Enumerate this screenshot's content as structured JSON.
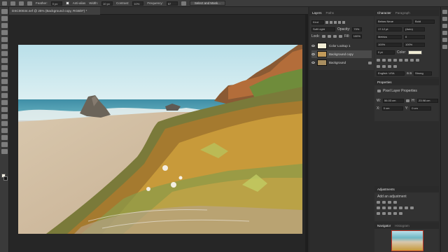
{
  "options_bar": {
    "feather_label": "Feather:",
    "feather_value": "0 px",
    "antialias_label": "Anti-alias",
    "width_label": "Width:",
    "width_value": "10 px",
    "contrast_label": "Contrast:",
    "contrast_value": "10%",
    "frequency_label": "Frequency:",
    "frequency_value": "57",
    "select_mask_label": "Select and Mask..."
  },
  "document": {
    "tab_title": "DSC00034.nef @ 25% (Background copy, RGB/8*) *"
  },
  "layers_panel": {
    "tabs": [
      "Layers",
      "Paths"
    ],
    "kind_filter": "Kind",
    "blend_mode": "Soft Light",
    "opacity_label": "Opacity:",
    "opacity_value": "70%",
    "lock_label": "Lock:",
    "fill_label": "Fill:",
    "fill_value": "100%",
    "layers": [
      {
        "name": "Color Lookup 1",
        "selected": false
      },
      {
        "name": "Background copy",
        "selected": true
      },
      {
        "name": "Background",
        "selected": false
      }
    ]
  },
  "character_panel": {
    "tabs": [
      "Character",
      "Paragraph"
    ],
    "font_family": "Bebas Neue",
    "font_style": "Bold",
    "font_size": "17.12 pt",
    "leading": "(Auto)",
    "kerning": "Metrics",
    "tracking": "0",
    "vertical_scale": "100%",
    "horizontal_scale": "100%",
    "baseline_shift": "0 pt",
    "color_label": "Color:",
    "color_value": "#f1ecd5",
    "language": "English: USA",
    "anti_alias": "Strong",
    "aa_label": "a a"
  },
  "properties_panel": {
    "title": "Properties",
    "subtitle": "Pixel Layer Properties",
    "w_label": "W:",
    "w_value": "56.03 cm",
    "h_label": "H:",
    "h_value": "23.98 cm",
    "x_label": "X:",
    "x_value": "0 cm",
    "y_label": "Y:",
    "y_value": "0 cm"
  },
  "adjustments_panel": {
    "title": "Adjustments",
    "subtitle": "Add an adjustment"
  },
  "navigator_panel": {
    "tabs": [
      "Navigator",
      "Histogram"
    ]
  },
  "colors": {
    "accent": "#4a4a4a",
    "panel_bg": "#323232",
    "canvas_bg": "#262626"
  }
}
